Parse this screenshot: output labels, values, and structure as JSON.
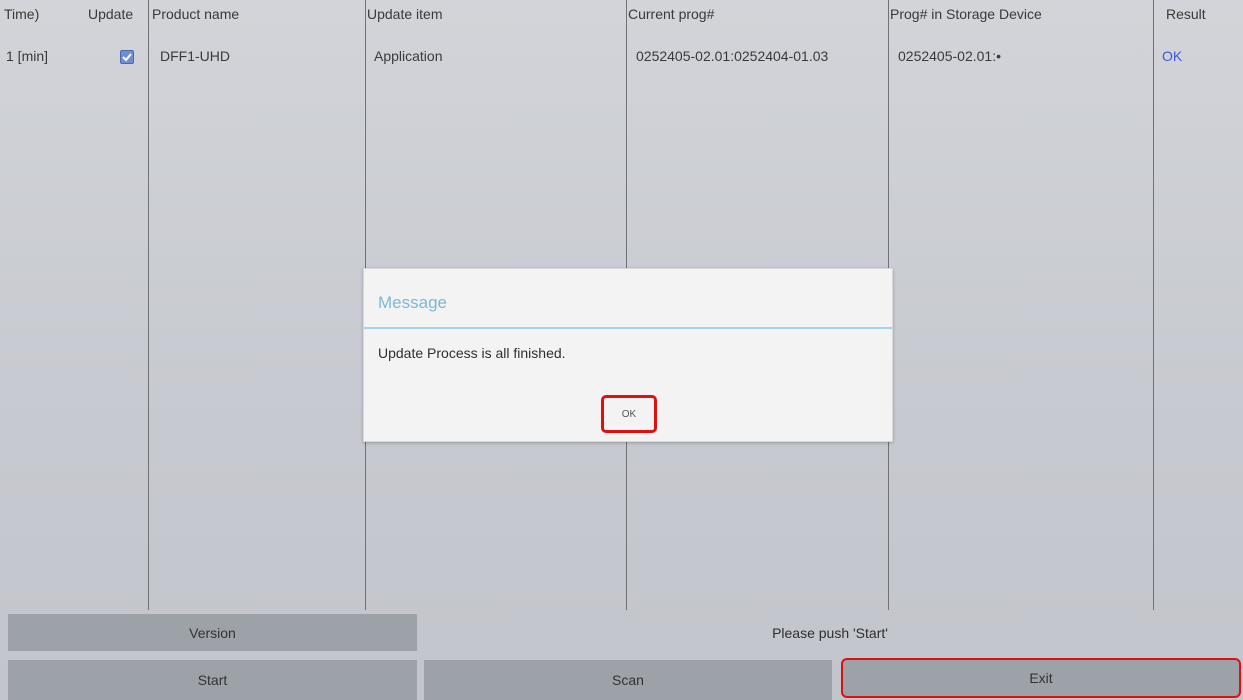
{
  "table": {
    "headers": [
      "Time)",
      "Update",
      "Product name",
      "Update item",
      "Current prog#",
      "Prog# in Storage Device",
      "Result"
    ],
    "rows": [
      {
        "time": "1 [min]",
        "update_checked": true,
        "product": "DFF1-UHD",
        "item": "Application",
        "current": "0252405-02.01:0252404-01.03",
        "storage": "0252405-02.01:•",
        "result": "OK"
      }
    ]
  },
  "dialog": {
    "title": "Message",
    "message": "Update Process is all finished.",
    "ok_label": "OK"
  },
  "footer": {
    "version_label": "Version",
    "status_text": "Please push 'Start'",
    "start_label": "Start",
    "scan_label": "Scan",
    "exit_label": "Exit"
  },
  "colors": {
    "highlight": "#e01010",
    "result_ok": "#3a5bd6",
    "dialog_title": "#7fb7d6"
  }
}
